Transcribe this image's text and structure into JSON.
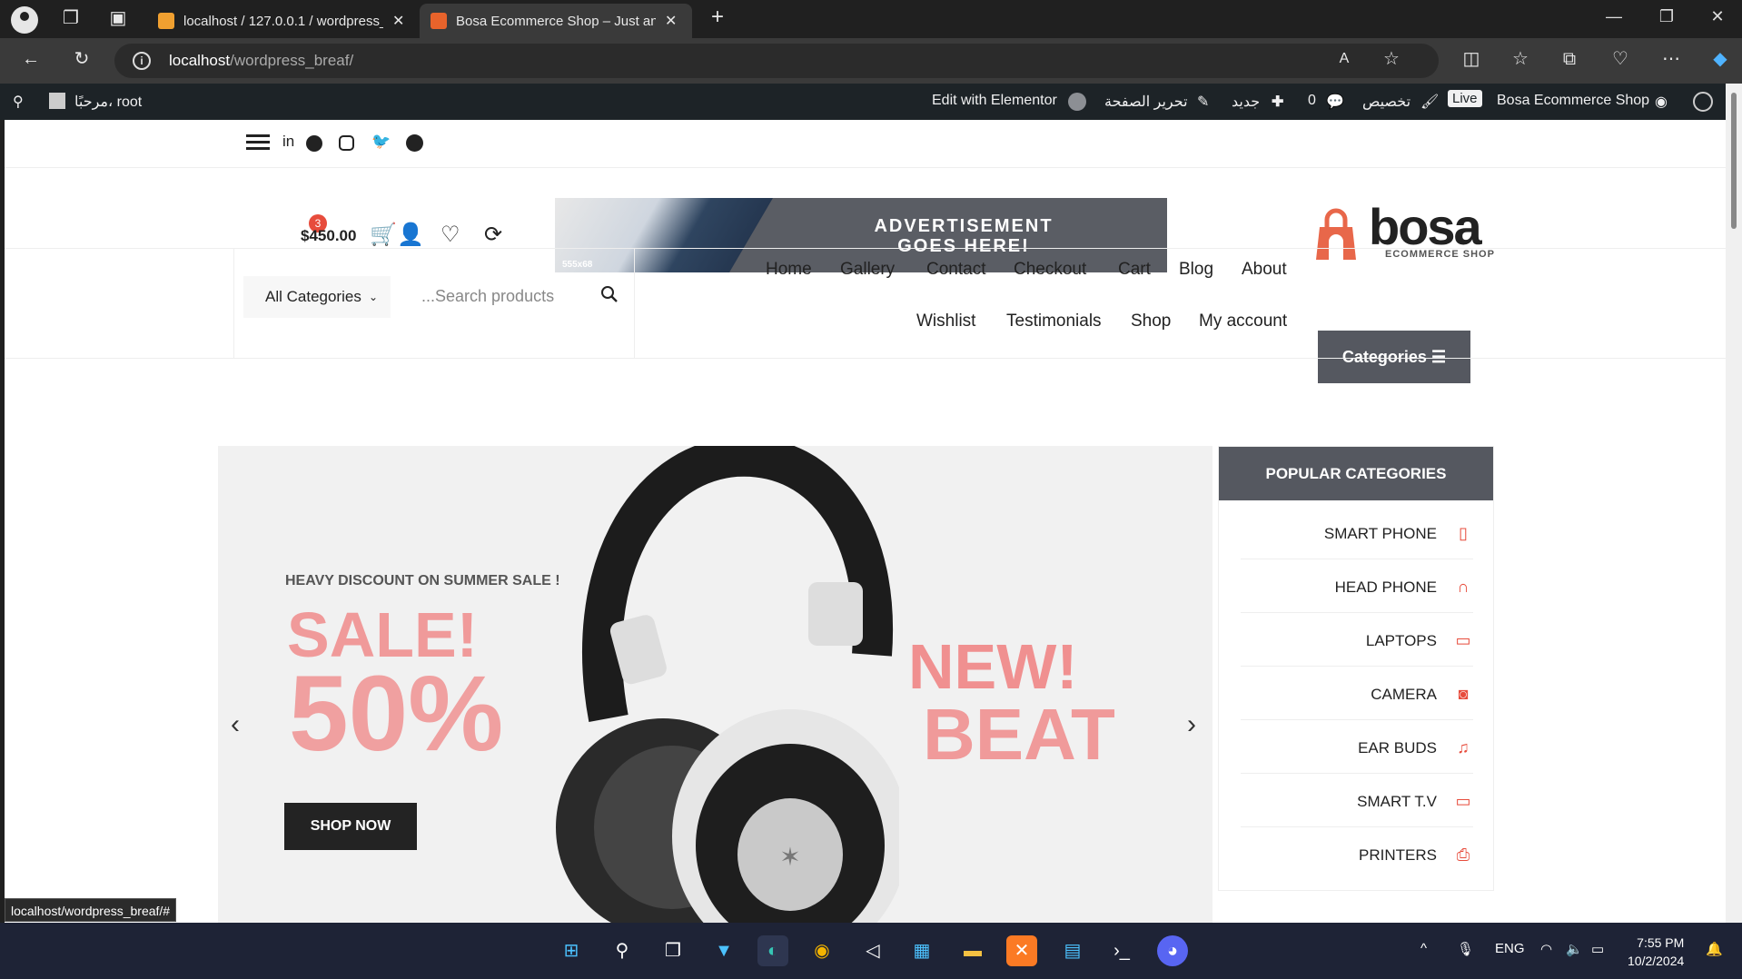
{
  "browser": {
    "tabs": [
      {
        "title": "localhost / 127.0.0.1 / wordpress_",
        "active": false
      },
      {
        "title": "Bosa Ecommerce Shop – Just ano",
        "active": true
      }
    ],
    "new_tab": "+",
    "url_host": "localhost",
    "url_path": "/wordpress_breaf/",
    "status_link": "localhost/wordpress_breaf/#"
  },
  "adminbar": {
    "greeting": "مرحبًا، root",
    "edit_elementor": "Edit with Elementor",
    "edit_page": "تحرير الصفحة",
    "new": "جديد",
    "comments": "0",
    "customize": "تخصيص",
    "live": "Live",
    "site_name": "Bosa Ecommerce Shop"
  },
  "header": {
    "cart_total": "$450.00",
    "cart_count": "3",
    "ad": {
      "line1": "ADVERTISEMENT",
      "line2": "GOES HERE!",
      "size": "555x68"
    },
    "logo": {
      "word": "bosa",
      "sub": "ECOMMERCE SHOP"
    },
    "accent": "#e74c3c"
  },
  "search": {
    "category": "All Categories",
    "placeholder": "...Search products"
  },
  "nav": {
    "row1": [
      "Home",
      "Gallery",
      "Contact",
      "Checkout",
      "Cart",
      "Blog",
      "About"
    ],
    "row2": [
      "Wishlist",
      "Testimonials",
      "Shop",
      "My account"
    ],
    "categories_button": "Categories"
  },
  "hero": {
    "kicker": "HEAVY DISCOUNT ON SUMMER SALE !",
    "sale": "SALE!",
    "percent": "50%",
    "new": "NEW!",
    "beat": "BEAT",
    "cta": "SHOP NOW"
  },
  "popular": {
    "title": "POPULAR CATEGORIES",
    "items": [
      {
        "label": "SMART PHONE",
        "icon": "mobile-icon"
      },
      {
        "label": "HEAD PHONE",
        "icon": "headphones-icon"
      },
      {
        "label": "LAPTOPS",
        "icon": "laptop-icon"
      },
      {
        "label": "CAMERA",
        "icon": "camera-icon"
      },
      {
        "label": "EAR BUDS",
        "icon": "music-icon"
      },
      {
        "label": "SMART T.V",
        "icon": "tv-icon"
      },
      {
        "label": "PRINTERS",
        "icon": "printer-icon"
      }
    ]
  },
  "taskbar": {
    "lang": "ENG",
    "time": "7:55 PM",
    "date": "10/2/2024"
  }
}
